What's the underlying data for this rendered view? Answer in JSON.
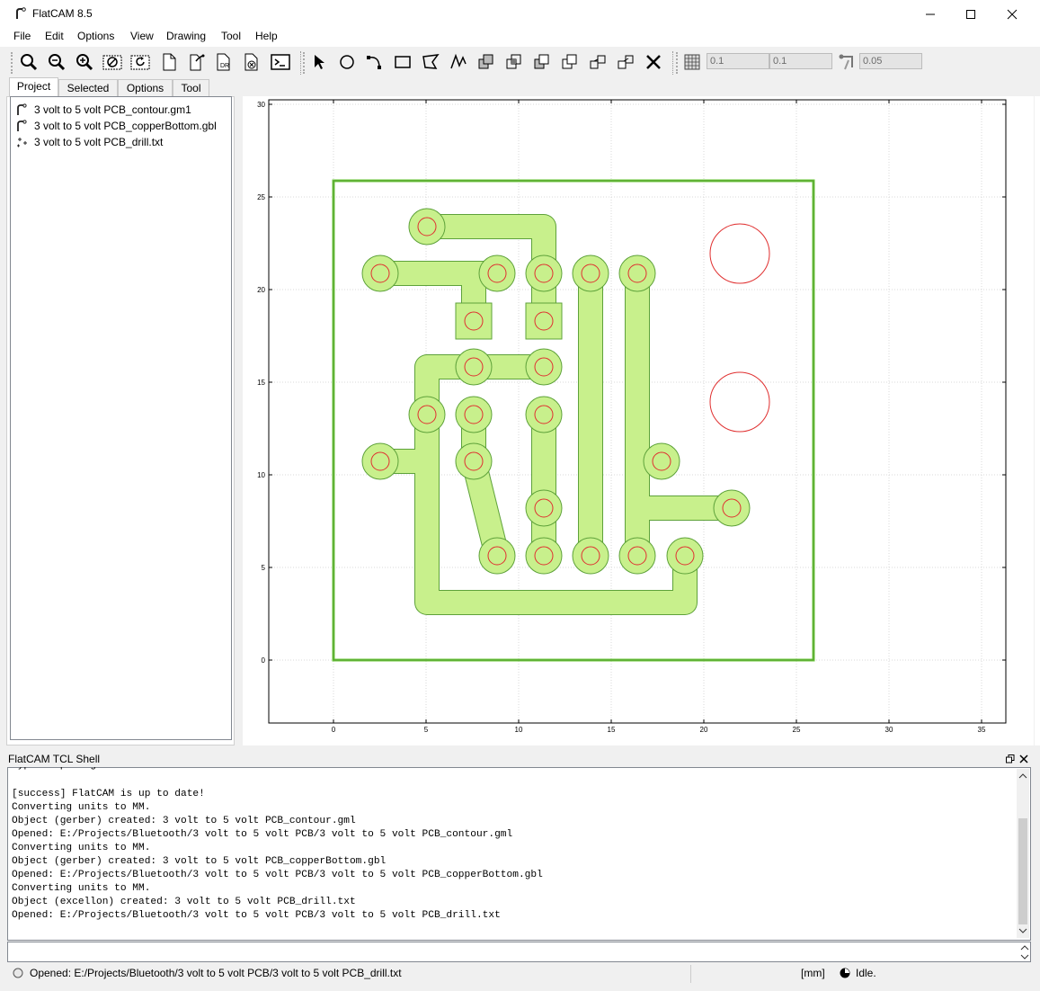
{
  "window": {
    "title": "FlatCAM 8.5"
  },
  "menu": [
    "File",
    "Edit",
    "Options",
    "View",
    "Drawing",
    "Tool",
    "Help"
  ],
  "toolbar": {
    "buttons": [
      "zoom-fit-icon",
      "zoom-out-icon",
      "zoom-in-icon",
      "clear-plot-icon",
      "replot-icon",
      "new-project-icon",
      "open-gerber-icon",
      "open-excellon-icon",
      "delete-object-icon",
      "shell-icon",
      "select-icon",
      "circle-icon",
      "arc-icon",
      "rectangle-icon",
      "polygon-icon",
      "path-icon",
      "union-icon",
      "intersection-icon",
      "subtract-icon",
      "cut-icon",
      "copy-icon",
      "move-icon",
      "delete-shape-icon"
    ],
    "grid_x": "0.1",
    "grid_y": "0.1",
    "snap_max": "0.05"
  },
  "tabs": [
    "Project",
    "Selected",
    "Options",
    "Tool"
  ],
  "project": {
    "items": [
      {
        "label": "3 volt to 5 volt PCB_contour.gm1",
        "icon": "gerber-icon"
      },
      {
        "label": "3 volt to 5 volt PCB_copperBottom.gbl",
        "icon": "gerber-icon"
      },
      {
        "label": "3 volt to 5 volt PCB_drill.txt",
        "icon": "excellon-icon"
      }
    ]
  },
  "plot": {
    "x_ticks": [
      "0",
      "5",
      "10",
      "15",
      "20",
      "25",
      "30",
      "35"
    ],
    "y_ticks": [
      "30",
      "25",
      "20",
      "15",
      "10",
      "5",
      "0"
    ],
    "colors": {
      "copper_fill": "#c8f08c",
      "copper_edge": "#5ea23a",
      "drill": "#e03030",
      "contour": "#6cc83c"
    }
  },
  "shell": {
    "title": "FlatCAM TCL Shell",
    "lines": [
      "Type help to get started.",
      "",
      "[success] FlatCAM is up to date!",
      "Converting units to MM.",
      "Object (gerber) created: 3 volt to 5 volt PCB_contour.gml",
      "Opened: E:/Projects/Bluetooth/3 volt to 5 volt PCB/3 volt to 5 volt PCB_contour.gml",
      "Converting units to MM.",
      "Object (gerber) created: 3 volt to 5 volt PCB_copperBottom.gbl",
      "Opened: E:/Projects/Bluetooth/3 volt to 5 volt PCB/3 volt to 5 volt PCB_copperBottom.gbl",
      "Converting units to MM.",
      "Object (excellon) created: 3 volt to 5 volt PCB_drill.txt",
      "Opened: E:/Projects/Bluetooth/3 volt to 5 volt PCB/3 volt to 5 volt PCB_drill.txt"
    ]
  },
  "status": {
    "message": "Opened: E:/Projects/Bluetooth/3 volt to 5 volt PCB/3 volt to 5 volt PCB_drill.txt",
    "units": "[mm]",
    "state": "Idle."
  }
}
